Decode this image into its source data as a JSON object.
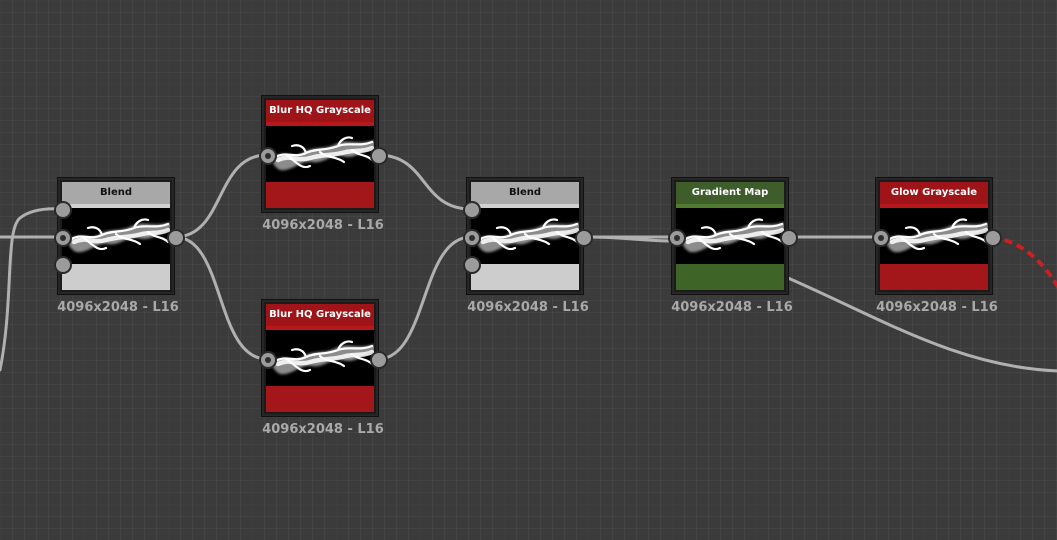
{
  "colors": {
    "canvas": "#3b3b3b",
    "wire": "#b0b0b0",
    "wire_invalid": "#cc1f1f",
    "blend_header": "#a8a8a8",
    "blur_header": "#9e1418",
    "gradient_header": "#3f5d2a",
    "glow_header": "#9e1418"
  },
  "nodes": [
    {
      "id": "blend_1",
      "title": "Blend",
      "resolution": "4096x2048 - L16",
      "style": "blend"
    },
    {
      "id": "blur_top",
      "title": "Blur HQ Grayscale",
      "resolution": "4096x2048 - L16",
      "style": "red"
    },
    {
      "id": "blur_bottom",
      "title": "Blur HQ Grayscale",
      "resolution": "4096x2048 - L16",
      "style": "red"
    },
    {
      "id": "blend_2",
      "title": "Blend",
      "resolution": "4096x2048 - L16",
      "style": "blend"
    },
    {
      "id": "gradient_map",
      "title": "Gradient Map",
      "resolution": "4096x2048 - L16",
      "style": "green"
    },
    {
      "id": "glow",
      "title": "Glow Grayscale",
      "resolution": "4096x2048 - L16",
      "style": "red"
    }
  ]
}
